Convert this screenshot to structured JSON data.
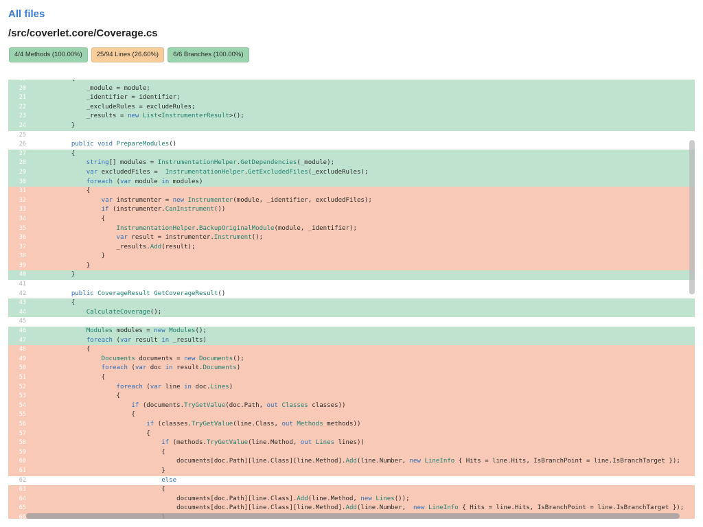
{
  "header": {
    "all_files_link": "All files",
    "file_path": "/src/coverlet.core/Coverage.cs"
  },
  "badges": [
    {
      "label": "4/4 Methods (100.00%)",
      "color": "#9bd3ae"
    },
    {
      "label": "25/94 Lines (26.60%)",
      "color": "#f6cd9b"
    },
    {
      "label": "6/6 Branches (100.00%)",
      "color": "#9bd3ae"
    }
  ],
  "colors": {
    "covered": "#c0e3d0",
    "uncovered": "#f8c9b7",
    "link": "#3a7bd5"
  },
  "code": {
    "lines": [
      {
        "n": "19",
        "cov": "cov",
        "text": "        {"
      },
      {
        "n": "20",
        "cov": "cov",
        "text": "            _module = module;"
      },
      {
        "n": "21",
        "cov": "cov",
        "text": "            _identifier = identifier;"
      },
      {
        "n": "22",
        "cov": "cov",
        "text": "            _excludeRules = excludeRules;"
      },
      {
        "n": "23",
        "cov": "cov",
        "text": "            _results = new List<InstrumenterResult>();"
      },
      {
        "n": "24",
        "cov": "cov",
        "text": "        }"
      },
      {
        "n": "25",
        "cov": "none",
        "text": ""
      },
      {
        "n": "26",
        "cov": "none",
        "text": "        public void PrepareModules()"
      },
      {
        "n": "27",
        "cov": "cov",
        "text": "        {"
      },
      {
        "n": "28",
        "cov": "cov",
        "text": "            string[] modules = InstrumentationHelper.GetDependencies(_module);"
      },
      {
        "n": "29",
        "cov": "cov",
        "text": "            var excludedFiles =  InstrumentationHelper.GetExcludedFiles(_excludeRules);"
      },
      {
        "n": "30",
        "cov": "cov",
        "text": "            foreach (var module in modules)"
      },
      {
        "n": "31",
        "cov": "unc",
        "text": "            {"
      },
      {
        "n": "32",
        "cov": "unc",
        "text": "                var instrumenter = new Instrumenter(module, _identifier, excludedFiles);"
      },
      {
        "n": "33",
        "cov": "unc",
        "text": "                if (instrumenter.CanInstrument())"
      },
      {
        "n": "34",
        "cov": "unc",
        "text": "                {"
      },
      {
        "n": "35",
        "cov": "unc",
        "text": "                    InstrumentationHelper.BackupOriginalModule(module, _identifier);"
      },
      {
        "n": "36",
        "cov": "unc",
        "text": "                    var result = instrumenter.Instrument();"
      },
      {
        "n": "37",
        "cov": "unc",
        "text": "                    _results.Add(result);"
      },
      {
        "n": "38",
        "cov": "unc",
        "text": "                }"
      },
      {
        "n": "39",
        "cov": "unc",
        "text": "            }"
      },
      {
        "n": "40",
        "cov": "cov",
        "text": "        }"
      },
      {
        "n": "41",
        "cov": "none",
        "text": ""
      },
      {
        "n": "42",
        "cov": "none",
        "text": "        public CoverageResult GetCoverageResult()"
      },
      {
        "n": "43",
        "cov": "cov",
        "text": "        {"
      },
      {
        "n": "44",
        "cov": "cov",
        "text": "            CalculateCoverage();"
      },
      {
        "n": "45",
        "cov": "none",
        "text": ""
      },
      {
        "n": "46",
        "cov": "cov",
        "text": "            Modules modules = new Modules();"
      },
      {
        "n": "47",
        "cov": "cov",
        "text": "            foreach (var result in _results)"
      },
      {
        "n": "48",
        "cov": "unc",
        "text": "            {"
      },
      {
        "n": "49",
        "cov": "unc",
        "text": "                Documents documents = new Documents();"
      },
      {
        "n": "50",
        "cov": "unc",
        "text": "                foreach (var doc in result.Documents)"
      },
      {
        "n": "51",
        "cov": "unc",
        "text": "                {"
      },
      {
        "n": "52",
        "cov": "unc",
        "text": "                    foreach (var line in doc.Lines)"
      },
      {
        "n": "53",
        "cov": "unc",
        "text": "                    {"
      },
      {
        "n": "54",
        "cov": "unc",
        "text": "                        if (documents.TryGetValue(doc.Path, out Classes classes))"
      },
      {
        "n": "55",
        "cov": "unc",
        "text": "                        {"
      },
      {
        "n": "56",
        "cov": "unc",
        "text": "                            if (classes.TryGetValue(line.Class, out Methods methods))"
      },
      {
        "n": "57",
        "cov": "unc",
        "text": "                            {"
      },
      {
        "n": "58",
        "cov": "unc",
        "text": "                                if (methods.TryGetValue(line.Method, out Lines lines))"
      },
      {
        "n": "59",
        "cov": "unc",
        "text": "                                {"
      },
      {
        "n": "60",
        "cov": "unc",
        "text": "                                    documents[doc.Path][line.Class][line.Method].Add(line.Number, new LineInfo { Hits = line.Hits, IsBranchPoint = line.IsBranchTarget });"
      },
      {
        "n": "61",
        "cov": "unc",
        "text": "                                }"
      },
      {
        "n": "62",
        "cov": "none",
        "text": "                                else"
      },
      {
        "n": "63",
        "cov": "unc",
        "text": "                                {"
      },
      {
        "n": "64",
        "cov": "unc",
        "text": "                                    documents[doc.Path][line.Class].Add(line.Method, new Lines());"
      },
      {
        "n": "65",
        "cov": "unc",
        "text": "                                    documents[doc.Path][line.Class][line.Method].Add(line.Number,  new LineInfo { Hits = line.Hits, IsBranchPoint = line.IsBranchTarget });"
      },
      {
        "n": "66",
        "cov": "unc",
        "text": "                                }"
      }
    ]
  }
}
